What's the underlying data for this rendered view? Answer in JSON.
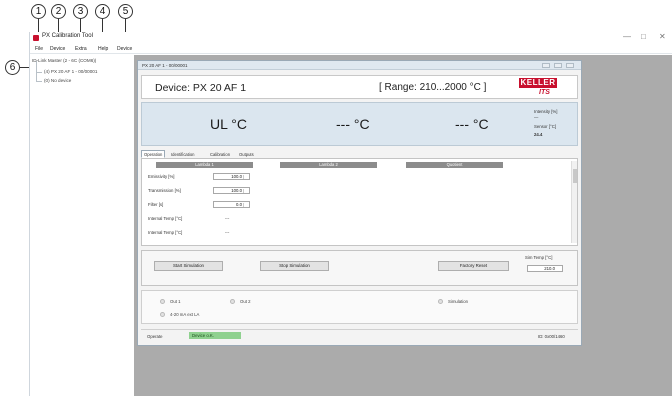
{
  "callouts": [
    "1",
    "2",
    "3",
    "4",
    "5",
    "6"
  ],
  "window": {
    "title": "PX Calibration Tool",
    "controls": [
      "—",
      "□",
      "✕"
    ]
  },
  "menu": [
    "File",
    "Device",
    "Extra",
    "Help",
    "Device"
  ],
  "tree": {
    "root": "ID-Link Master (2 - 6C (COM6))",
    "child": "(4) PX 20 AF 1 - 00/00001",
    "leaf": "(0) No device"
  },
  "child_window": {
    "title": "PX 20 AF 1 - 00/00001",
    "device_label": "Device:   PX 20 AF 1",
    "range": "[ Range: 210...2000 °C ]",
    "logo_top": "KELLER",
    "logo_bottom": "ITS",
    "readings": [
      "UL °C",
      "--- °C",
      "--- °C"
    ],
    "side": {
      "intensity_label": "Intensity [%]",
      "intensity_value": "—",
      "sensor_label": "Sensor [°C]",
      "sensor_value": "24.4"
    },
    "tabs": [
      "Operation",
      "Identification",
      "Calibration",
      "Outputs"
    ],
    "columns": [
      "Lambda 1",
      "Lambda 2",
      "Quotient"
    ],
    "rows": [
      {
        "label": "Emissivity [%]",
        "value": "100.0"
      },
      {
        "label": "Transmission [%]",
        "value": "100.0"
      },
      {
        "label": "Filter [s]",
        "value": "0.0"
      },
      {
        "label": "Internal Temp [°C]",
        "value": "---"
      },
      {
        "label": "Internal Temp [°C]",
        "value": "---"
      }
    ],
    "buttons": {
      "start": "Start Simulation",
      "stop": "Stop Simulation",
      "factory": "Factory Reset"
    },
    "sim_temp_label": "Sim Temp [°C]",
    "sim_temp_value": "210.0",
    "io": {
      "out1": "Out 1",
      "out2": "Out 2",
      "simulation": "Simulation",
      "ext": "4-20 mA ext LA"
    },
    "status": {
      "label": "Operate",
      "state": "Device o.K.",
      "id": "ID: 0x00/1460"
    }
  }
}
